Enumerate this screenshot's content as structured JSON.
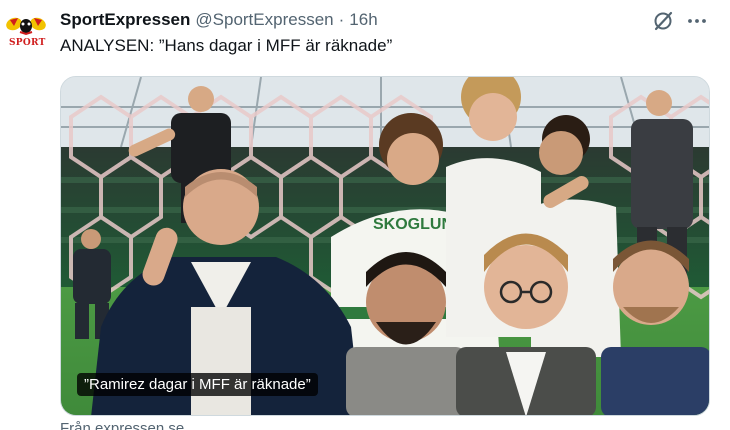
{
  "author": {
    "display_name": "SportExpressen",
    "handle": "@SportExpressen",
    "separator": "·",
    "time": "16h",
    "avatar_word": "SPORT"
  },
  "tweet": {
    "text": "ANALYSEN: ”Hans dagar i MFF är räknade”"
  },
  "media": {
    "caption": "”Ramirez dagar i MFF är räknade”",
    "jersey_text": "SKOGLUND"
  },
  "link": {
    "source": "Från expressen.se"
  },
  "icons": {
    "grok": "grok-icon",
    "more": "more-icon"
  },
  "colors": {
    "text_primary": "#0f1419",
    "text_secondary": "#536471",
    "border": "#cfd9de",
    "pitch_green": "#3f8a3a",
    "crowd_green": "#1f5a35"
  }
}
